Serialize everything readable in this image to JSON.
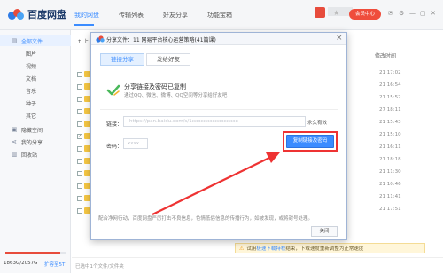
{
  "app": {
    "name": "百度网盘",
    "nav": [
      "我的网盘",
      "传输列表",
      "好友分享",
      "功能宝箱"
    ],
    "vip_label": "会员中心"
  },
  "sidebar": {
    "items": [
      {
        "label": "全部文件",
        "icon": "folder-icon"
      },
      {
        "label": "图片"
      },
      {
        "label": "视频"
      },
      {
        "label": "文档"
      },
      {
        "label": "音乐"
      },
      {
        "label": "种子"
      },
      {
        "label": "其它"
      },
      {
        "label": "隐藏空间",
        "icon": "lock-icon"
      },
      {
        "label": "我的分享",
        "icon": "share-icon"
      },
      {
        "label": "回收站",
        "icon": "trash-icon"
      }
    ],
    "quota_text": "1863G/2057G",
    "quota_fraction": 0.906,
    "expand_label": "扩容至5T"
  },
  "file_list": {
    "up_label": "上",
    "time_header": "修改时间",
    "times": [
      "21 17:02",
      "21 16:54",
      "21 15:52",
      "27 18:11",
      "21 15:43",
      "21 15:10",
      "21 16:11",
      "21 18:18",
      "21 11:30",
      "21 10:46",
      "21 11:41",
      "21 17:51"
    ],
    "status": "已选中1个文件/文件夹"
  },
  "notice": {
    "prefix": "试用",
    "highlight": "极速下载特权",
    "suffix": "结束，下载速度重新调整为正常速度"
  },
  "modal": {
    "title": "分享文件：11 网易平台核心运营策略(41篇课)",
    "tabs": [
      "链接分享",
      "发给好友"
    ],
    "success_title": "分享链接及密码已复制",
    "success_sub": "通过QQ、微信、微博、QQ空间等分享给好友吧",
    "link_label": "链接：",
    "link_value": "https://pan.baidu.com/s/1xxxxxxxxxxxxxxxx",
    "link_validity": "永久有效",
    "code_label": "密码：",
    "code_value": "xxxx",
    "copy_button": "复制链接及密码",
    "footer_note": "配合净网行动，百度网盘严厉打击不良信息，色情低俗信息的传播行为，如被发现，或将封号处理。",
    "close_button": "关闭"
  },
  "colors": {
    "accent": "#3b8cff",
    "vip": "#ef4d3c",
    "annotation": "#e33333"
  }
}
